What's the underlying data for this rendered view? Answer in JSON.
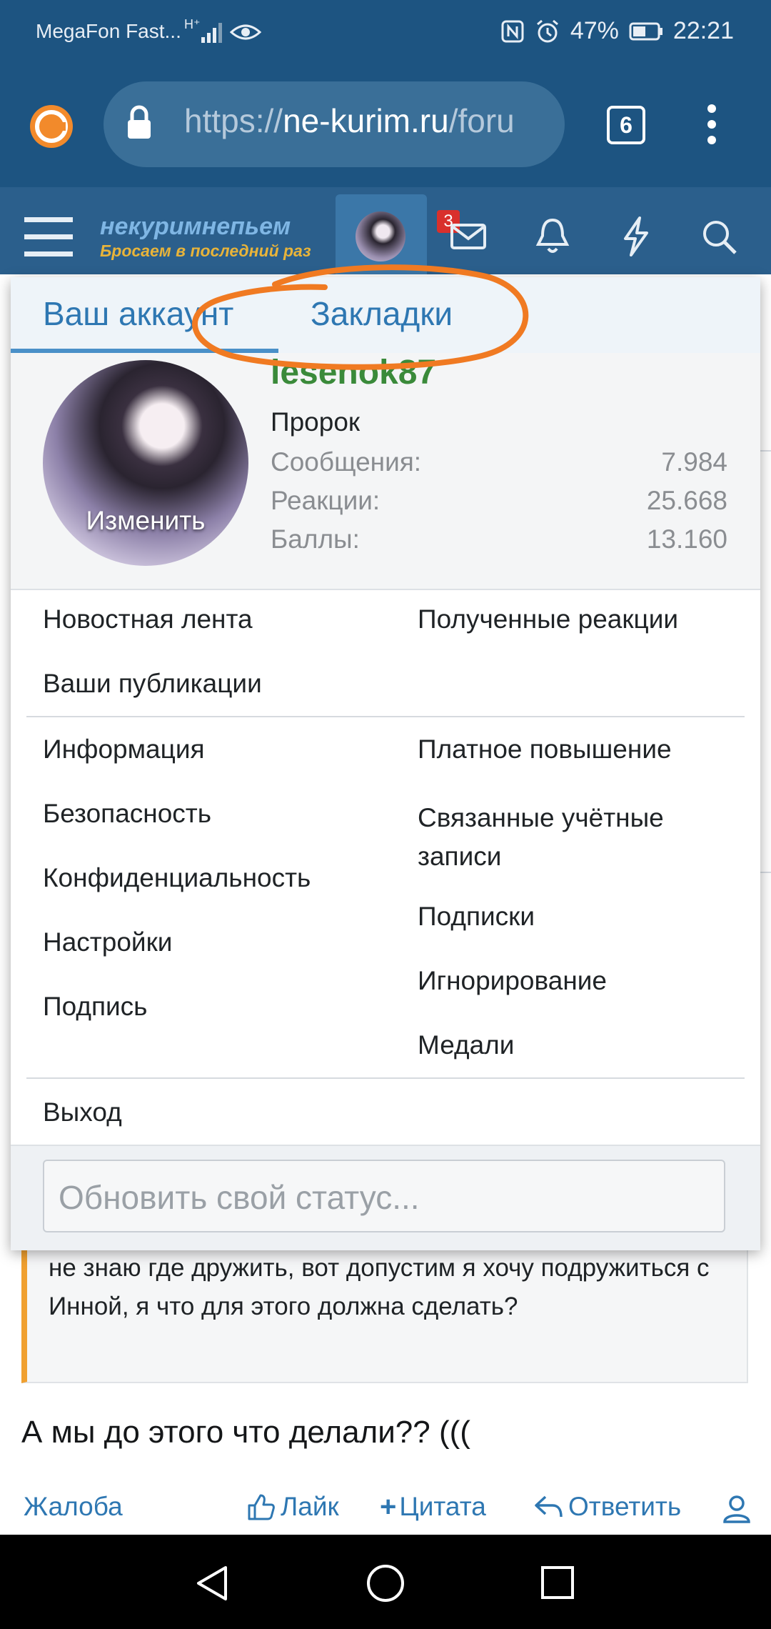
{
  "status_bar": {
    "carrier": "MegaFon Fast...",
    "battery": "47%",
    "time": "22:21"
  },
  "browser": {
    "url_scheme": "https://",
    "url_host": "ne-kurim.ru",
    "url_path": "/foru",
    "tab_count": "6"
  },
  "forum_header": {
    "logo_line1": "некуримнепьем",
    "logo_line2": "Бросаем в последний раз",
    "messages_badge": "3"
  },
  "account_popup": {
    "tabs": [
      "Ваш аккаунт",
      "Закладки"
    ],
    "username": "lesenok87",
    "user_title": "Пророк",
    "avatar_change_label": "Изменить",
    "stats": [
      {
        "label": "Сообщения:",
        "value": "7.984"
      },
      {
        "label": "Реакции:",
        "value": "25.668"
      },
      {
        "label": "Баллы:",
        "value": "13.160"
      }
    ],
    "group1_left": [
      "Новостная лента",
      "Ваши публикации"
    ],
    "group1_right": [
      "Полученные реакции"
    ],
    "group2_left": [
      "Информация",
      "Безопасность",
      "Конфиденциальность",
      "Настройки",
      "Подпись"
    ],
    "group2_right": [
      "Платное повышение",
      "Связанные учётные записи",
      "Подписки",
      "Игнорирование",
      "Медали"
    ],
    "logout": "Выход",
    "status_placeholder": "Обновить свой статус..."
  },
  "post": {
    "quote_text": "не знаю где дружить, вот допустим я хочу подружиться с Инной, я что для этого должна сделать?",
    "body_text": "А мы до этого что делали?? (((",
    "actions": {
      "report": "Жалоба",
      "like": "Лайк",
      "quote": "Цитата",
      "reply": "Ответить"
    }
  },
  "colors": {
    "header_dark": "#1d5481",
    "forum_header": "#2b5f8c",
    "link_blue": "#2e77b2",
    "username_green": "#3a8a3a",
    "annotation_orange": "#f07a22",
    "quote_bar": "#f0a030"
  }
}
